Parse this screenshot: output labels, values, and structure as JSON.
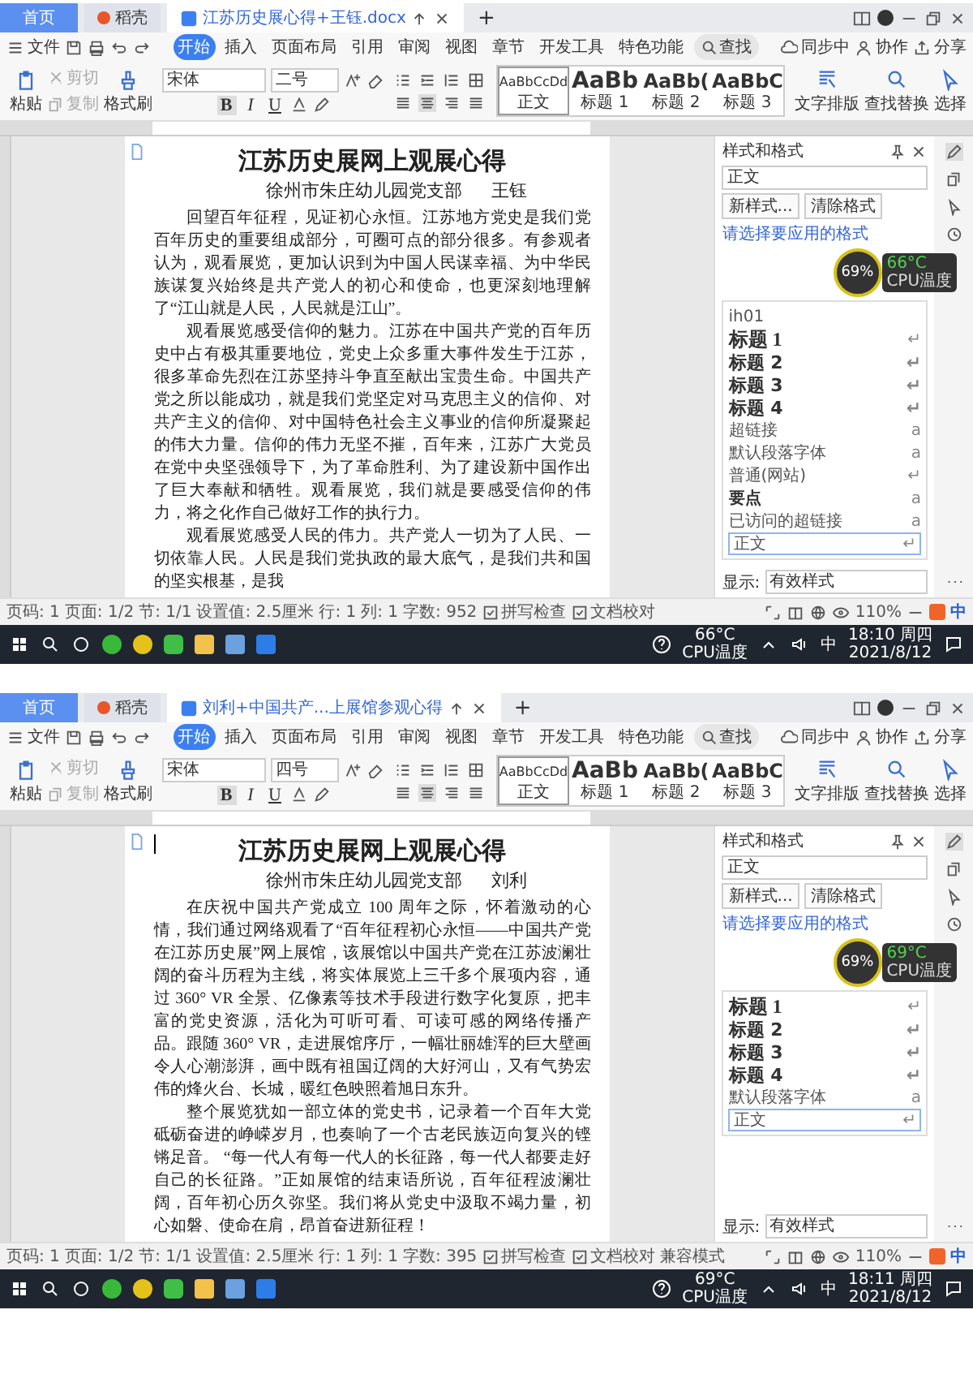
{
  "screens": [
    {
      "browser_tabs": [
        {
          "label": "首页",
          "kind": "home",
          "selected": false
        },
        {
          "label": "稻壳",
          "kind": "app",
          "selected": false
        },
        {
          "label": "江苏历史展心得+王钰.docx",
          "kind": "doc",
          "selected": true
        }
      ],
      "new_tab": "+",
      "file_menu": "文件",
      "menu_tabs": [
        {
          "label": "开始",
          "selected": true
        },
        {
          "label": "插入",
          "selected": false
        },
        {
          "label": "页面布局",
          "selected": false
        },
        {
          "label": "引用",
          "selected": false
        },
        {
          "label": "审阅",
          "selected": false
        },
        {
          "label": "视图",
          "selected": false
        },
        {
          "label": "章节",
          "selected": false
        },
        {
          "label": "开发工具",
          "selected": false
        },
        {
          "label": "特色功能",
          "selected": false
        }
      ],
      "search": "查找",
      "actions": [
        "同步中",
        "协作",
        "分享"
      ],
      "clipboard": [
        {
          "label": "粘贴",
          "kind": "paste",
          "disabled": false
        },
        {
          "label": "剪切",
          "kind": "cut",
          "disabled": true
        },
        {
          "label": "复制",
          "kind": "copy",
          "disabled": true
        },
        {
          "label": "格式刷",
          "kind": "brush",
          "disabled": false
        }
      ],
      "font": "宋体",
      "size": "二号",
      "format_buttons": [
        "B",
        "I",
        "U"
      ],
      "styles": [
        {
          "sample": "AaBbCcDd",
          "label": "正文",
          "kind": "body",
          "selected": true
        },
        {
          "sample": "AaBb",
          "label": "标题 1",
          "kind": "h1",
          "selected": false
        },
        {
          "sample": "AaBb(",
          "label": "标题 2",
          "kind": "h2",
          "selected": false
        },
        {
          "sample": "AaBbC",
          "label": "标题 3",
          "kind": "h3",
          "selected": false
        }
      ],
      "tools": [
        {
          "label": "文字排版",
          "kind": "layout"
        },
        {
          "label": "查找替换",
          "kind": "find"
        },
        {
          "label": "选择",
          "kind": "select"
        }
      ],
      "document": {
        "cursor": false,
        "title": "江苏历史展网上观展心得",
        "author_unit": "徐州市朱庄幼儿园党支部",
        "author": "王钰",
        "paragraphs": [
          "回望百年征程，见证初心永恒。江苏地方党史是我们党百年历史的重要组成部分，可圈可点的部分很多。有参观者认为，观看展览，更加认识到为中国人民谋幸福、为中华民族谋复兴始终是共产党人的初心和使命，也更深刻地理解了“江山就是人民，人民就是江山”。",
          "观看展览感受信仰的魅力。江苏在中国共产党的百年历史中占有极其重要地位，党史上众多重大事件发生于江苏，很多革命先烈在江苏坚持斗争直至献出宝贵生命。中国共产党之所以能成功，就是我们党坚定对马克思主义的信仰、对共产主义的信仰、对中国特色社会主义事业的信仰所凝聚起的伟大力量。信仰的伟力无坚不摧，百年来，江苏广大党员在党中央坚强领导下，为了革命胜利、为了建设新中国作出了巨大奉献和牺牲。观看展览，我们就是要感受信仰的伟力，将之化作自己做好工作的执行力。",
          "观看展览感受人民的伟力。共产党人一切为了人民、一切依靠人民。人民是我们党执政的最大底气，是我们共和国的坚实根基，是我"
        ]
      },
      "pane": {
        "title": "样式和格式",
        "current": "正文",
        "buttons": [
          "新样式...",
          "清除格式"
        ],
        "prompt": "请选择要应用的格式",
        "styles": [
          {
            "label": "ih01",
            "kind": "plain",
            "selected": false
          },
          {
            "label": "标题 1",
            "kind": "h1",
            "mark": "↵",
            "selected": false
          },
          {
            "label": "标题 2",
            "kind": "h2",
            "mark": "↵",
            "selected": false
          },
          {
            "label": "标题 3",
            "kind": "h3",
            "mark": "↵",
            "selected": false
          },
          {
            "label": "标题 4",
            "kind": "h4",
            "mark": "↵",
            "selected": false
          },
          {
            "label": "超链接",
            "kind": "plain",
            "mark": "a",
            "selected": false
          },
          {
            "label": "默认段落字体",
            "kind": "plain",
            "mark": "a",
            "selected": false
          },
          {
            "label": "普通(网站)",
            "kind": "plain",
            "mark": "↵",
            "selected": false
          },
          {
            "label": "要点",
            "kind": "strong",
            "mark": "a",
            "selected": false
          },
          {
            "label": "已访问的超链接",
            "kind": "plain",
            "mark": "a",
            "selected": false
          },
          {
            "label": "正文",
            "kind": "plain",
            "mark": "↵",
            "selected": true
          }
        ],
        "show_label": "显示:",
        "show_value": "有效样式"
      },
      "cpu": {
        "percent": "69%",
        "temp": "66°C",
        "label": "CPU温度"
      },
      "status": [
        {
          "label": "页码: 1",
          "kind": "text"
        },
        {
          "label": "页面: 1/2",
          "kind": "text"
        },
        {
          "label": "节: 1/1",
          "kind": "text"
        },
        {
          "label": "设置值: 2.5厘米",
          "kind": "text"
        },
        {
          "label": "行: 1",
          "kind": "text"
        },
        {
          "label": "列: 1",
          "kind": "text"
        },
        {
          "label": "字数: 952",
          "kind": "text"
        },
        {
          "label": "拼写检查",
          "kind": "button"
        },
        {
          "label": "文档校对",
          "kind": "button"
        }
      ],
      "zoom": "110%",
      "ime": "中",
      "taskbar": {
        "temp": "66°C",
        "temp_label": "CPU温度",
        "ime": "中",
        "time": "18:10 周四",
        "date": "2021/8/12"
      }
    },
    {
      "browser_tabs": [
        {
          "label": "首页",
          "kind": "home",
          "selected": false
        },
        {
          "label": "稻壳",
          "kind": "app",
          "selected": false
        },
        {
          "label": "刘利+中国共产...上展馆参观心得",
          "kind": "doc",
          "selected": true
        }
      ],
      "new_tab": "+",
      "file_menu": "文件",
      "menu_tabs": [
        {
          "label": "开始",
          "selected": true
        },
        {
          "label": "插入",
          "selected": false
        },
        {
          "label": "页面布局",
          "selected": false
        },
        {
          "label": "引用",
          "selected": false
        },
        {
          "label": "审阅",
          "selected": false
        },
        {
          "label": "视图",
          "selected": false
        },
        {
          "label": "章节",
          "selected": false
        },
        {
          "label": "开发工具",
          "selected": false
        },
        {
          "label": "特色功能",
          "selected": false
        }
      ],
      "search": "查找",
      "actions": [
        "同步中",
        "协作",
        "分享"
      ],
      "clipboard": [
        {
          "label": "粘贴",
          "kind": "paste",
          "disabled": false
        },
        {
          "label": "剪切",
          "kind": "cut",
          "disabled": true
        },
        {
          "label": "复制",
          "kind": "copy",
          "disabled": true
        },
        {
          "label": "格式刷",
          "kind": "brush",
          "disabled": false
        }
      ],
      "font": "宋体",
      "size": "四号",
      "format_buttons": [
        "B",
        "I",
        "U"
      ],
      "styles": [
        {
          "sample": "AaBbCcDd",
          "label": "正文",
          "kind": "body",
          "selected": true
        },
        {
          "sample": "AaBb",
          "label": "标题 1",
          "kind": "h1",
          "selected": false
        },
        {
          "sample": "AaBb(",
          "label": "标题 2",
          "kind": "h2",
          "selected": false
        },
        {
          "sample": "AaBbC",
          "label": "标题 3",
          "kind": "h3",
          "selected": false
        }
      ],
      "tools": [
        {
          "label": "文字排版",
          "kind": "layout"
        },
        {
          "label": "查找替换",
          "kind": "find"
        },
        {
          "label": "选择",
          "kind": "select"
        }
      ],
      "document": {
        "cursor": true,
        "title": "江苏历史展网上观展心得",
        "author_unit": "徐州市朱庄幼儿园党支部",
        "author": "刘利",
        "paragraphs": [
          "在庆祝中国共产党成立 100 周年之际，怀着激动的心情，我们通过网络观看了“百年征程初心永恒——中国共产党在江苏历史展”网上展馆，该展馆以中国共产党在江苏波澜壮阔的奋斗历程为主线，将实体展览上三千多个展项内容，通过 360° VR 全景、亿像素等技术手段进行数字化复原，把丰富的党史资源，活化为可听可看、可读可感的网络传播产品。跟随 360° VR，走进展馆序厅，一幅壮丽雄浑的巨大壁画令人心潮澎湃，画中既有祖国辽阔的大好河山，又有气势宏伟的烽火台、长城，暖红色映照着旭日东升。",
          "整个展览犹如一部立体的党史书，记录着一个百年大党砥砺奋进的峥嵘岁月，也奏响了一个古老民族迈向复兴的铿锵足音。 “每一代人有每一代人的长征路，每一代人都要走好自己的长征路。”正如展馆的结束语所说，百年征程波澜壮阔，百年初心历久弥坚。我们将从党史中汲取不竭力量，初心如磐、使命在肩，昂首奋进新征程！"
        ]
      },
      "pane": {
        "title": "样式和格式",
        "current": "正文",
        "buttons": [
          "新样式...",
          "清除格式"
        ],
        "prompt": "请选择要应用的格式",
        "styles": [
          {
            "label": "标题 1",
            "kind": "h1",
            "mark": "↵",
            "selected": false
          },
          {
            "label": "标题 2",
            "kind": "h2",
            "mark": "↵",
            "selected": false
          },
          {
            "label": "标题 3",
            "kind": "h3",
            "mark": "↵",
            "selected": false
          },
          {
            "label": "标题 4",
            "kind": "h4",
            "mark": "↵",
            "selected": false
          },
          {
            "label": "默认段落字体",
            "kind": "plain",
            "mark": "a",
            "selected": false
          },
          {
            "label": "正文",
            "kind": "plain",
            "mark": "↵",
            "selected": true
          }
        ],
        "show_label": "显示:",
        "show_value": "有效样式"
      },
      "cpu": {
        "percent": "69%",
        "temp": "69°C",
        "label": "CPU温度"
      },
      "status": [
        {
          "label": "页码: 1",
          "kind": "text"
        },
        {
          "label": "页面: 1/2",
          "kind": "text"
        },
        {
          "label": "节: 1/1",
          "kind": "text"
        },
        {
          "label": "设置值: 2.5厘米",
          "kind": "text"
        },
        {
          "label": "行: 1",
          "kind": "text"
        },
        {
          "label": "列: 1",
          "kind": "text"
        },
        {
          "label": "字数: 395",
          "kind": "text"
        },
        {
          "label": "拼写检查",
          "kind": "button"
        },
        {
          "label": "文档校对",
          "kind": "button"
        },
        {
          "label": "兼容模式",
          "kind": "text"
        }
      ],
      "zoom": "110%",
      "ime": "中",
      "taskbar": {
        "temp": "69°C",
        "temp_label": "CPU温度",
        "ime": "中",
        "time": "18:11 周四",
        "date": "2021/8/12"
      }
    }
  ]
}
